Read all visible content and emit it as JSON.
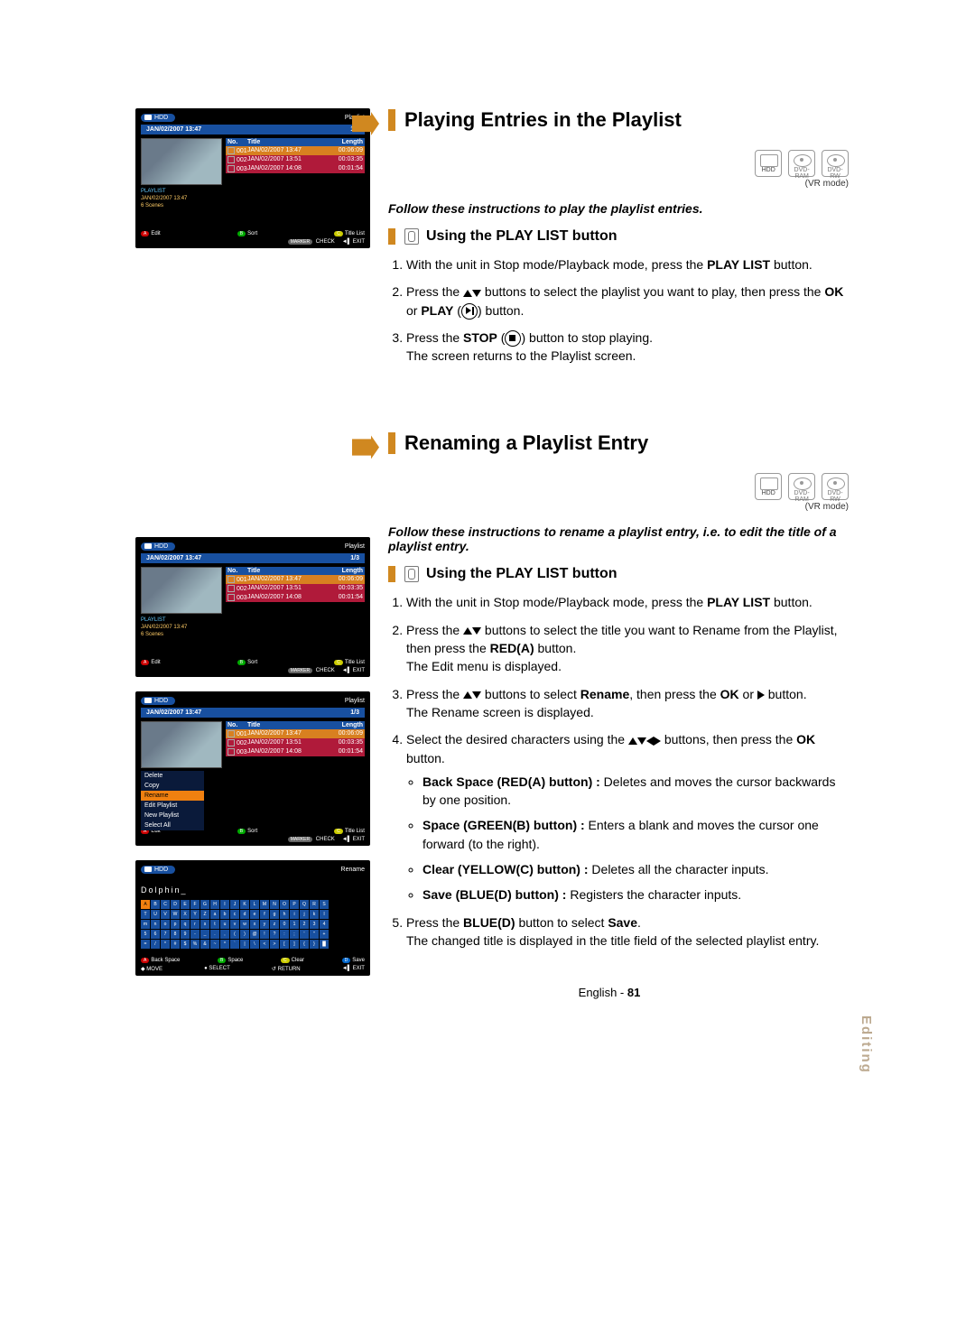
{
  "side_tab": "Editing",
  "screenshots": {
    "common": {
      "hdd_label": "HDD",
      "mode_label": "Playlist",
      "timestamp": "JAN/02/2007 13:47",
      "count": "1/3",
      "table_head": {
        "no": "No.",
        "title": "Title",
        "length": "Length"
      },
      "rows": [
        {
          "no": "001",
          "title": "JAN/02/2007 13:47",
          "length": "00:06:09"
        },
        {
          "no": "002",
          "title": "JAN/02/2007 13:51",
          "length": "00:03:35"
        },
        {
          "no": "003",
          "title": "JAN/02/2007 14:08",
          "length": "00:01:54"
        }
      ],
      "meta": [
        "PLAYLIST",
        "JAN/02/2007 13:47",
        "6 Scenes"
      ],
      "foot": {
        "edit": "Edit",
        "sort": "Sort",
        "title_list": "Title List",
        "check": "CHECK",
        "marker": "MARKER",
        "exit": "EXIT"
      }
    },
    "ctx_menu": [
      "Delete",
      "Copy",
      "Rename",
      "Edit Playlist",
      "New Playlist",
      "Select All"
    ],
    "rename": {
      "mode_label": "Rename",
      "input": "Dolphin_",
      "foot": {
        "back": "Back Space",
        "space": "Space",
        "clear": "Clear",
        "save": "Save",
        "move": "MOVE",
        "select": "SELECT",
        "return": "RETURN",
        "exit": "EXIT"
      }
    }
  },
  "section1": {
    "title": "Playing Entries in the Playlist",
    "media": {
      "hdd": "HDD",
      "ram": "DVD-RAM",
      "rw": "DVD-RW"
    },
    "vrmode": "(VR mode)",
    "lead": "Follow these instructions to play the playlist entries.",
    "sub_title": "Using the PLAY LIST button",
    "s1a": "With the unit in Stop mode/Playback mode, press the ",
    "s1b": "PLAY LIST",
    "s1c": " button.",
    "s2a": "Press the ",
    "s2b": " buttons to select the playlist you want to play, then press the ",
    "s2c": "OK",
    "s2d": " or ",
    "s2e": "PLAY",
    "s2f": " button.",
    "s3a": "Press the ",
    "s3b": "STOP",
    "s3c": " button to stop playing.",
    "s3d": "The screen returns to the Playlist screen."
  },
  "section2": {
    "title": "Renaming a Playlist Entry",
    "vrmode": "(VR mode)",
    "lead": "Follow these instructions to rename a playlist entry, i.e. to edit the title of a playlist entry.",
    "sub_title": "Using the PLAY LIST button",
    "s1a": "With the unit in Stop mode/Playback mode, press the ",
    "s1b": "PLAY LIST",
    "s1c": " button.",
    "s2a": "Press the ",
    "s2b": " buttons to select the title you want to Rename from the Playlist, then press the ",
    "s2c": "RED(A)",
    "s2d": " button.",
    "s2e": "The Edit menu is displayed.",
    "s3a": "Press the ",
    "s3b": " buttons to select ",
    "s3c": "Rename",
    "s3d": ", then press the ",
    "s3e": "OK",
    "s3f": " or ",
    "s3g": " button.",
    "s3h": "The Rename screen is displayed.",
    "s4a": "Select the desired characters using the ",
    "s4b": " buttons, then press the ",
    "s4c": "OK",
    "s4d": " button.",
    "bul1a": "Back Space (RED(A) button) :",
    "bul1b": " Deletes and moves the cursor backwards by one position.",
    "bul2a": "Space (GREEN(B) button) :",
    "bul2b": " Enters a blank and moves the cursor one forward (to the right).",
    "bul3a": "Clear (YELLOW(C) button) :",
    "bul3b": " Deletes all the character inputs.",
    "bul4a": "Save (BLUE(D) button) :",
    "bul4b": " Registers the character inputs.",
    "s5a": "Press the ",
    "s5b": "BLUE(D)",
    "s5c": " button to select ",
    "s5d": "Save",
    "s5e": ".",
    "s5f": "The changed title is displayed in the title field of the selected playlist entry."
  },
  "footer": {
    "lang": "English",
    "page": "81"
  }
}
